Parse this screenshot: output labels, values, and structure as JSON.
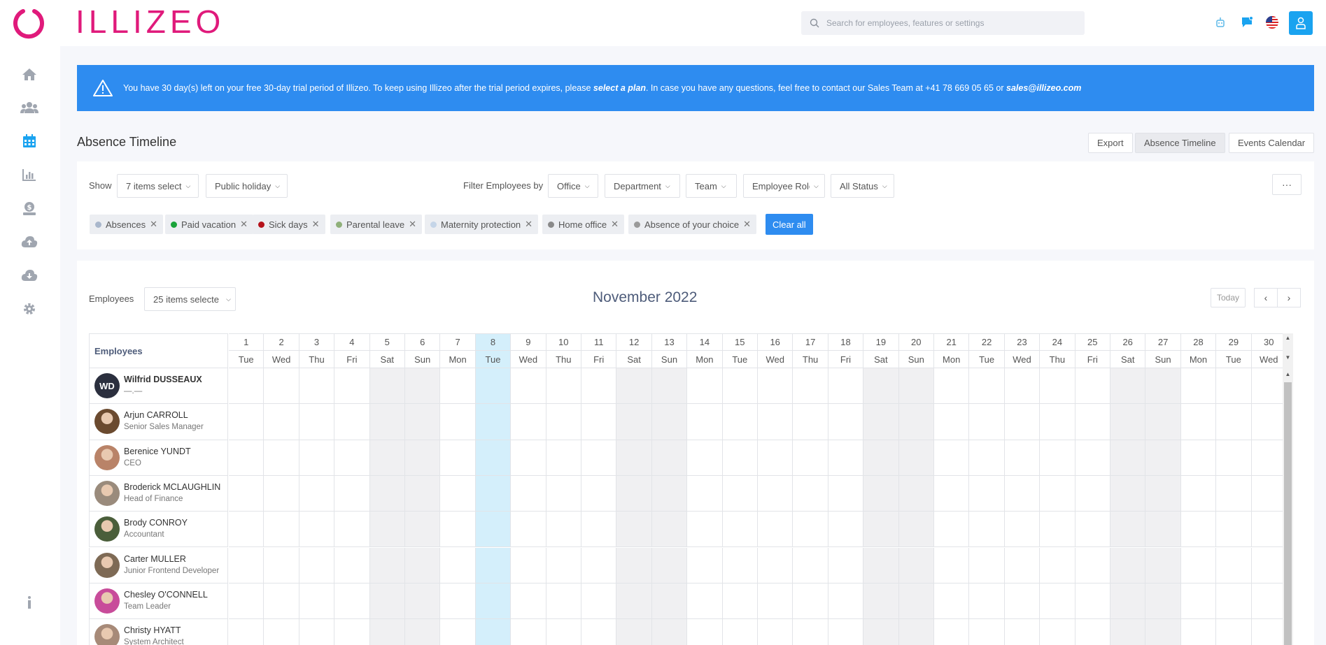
{
  "app": {
    "logo_text": "ILLIZEO"
  },
  "search": {
    "placeholder": "Search for employees, features or settings"
  },
  "banner": {
    "text_before": "You have 30 day(s) left on your free 30-day trial period of Illizeo. To keep using Illizeo after the trial period expires, please ",
    "link_text": "select a plan",
    "text_after": ". In case you have any questions, feel free to contact our Sales Team at +41 78 669 05 65 or ",
    "email": "sales@illizeo.com"
  },
  "page": {
    "title": "Absence Timeline"
  },
  "views": {
    "export": "Export",
    "timeline": "Absence Timeline",
    "events": "Events Calendar"
  },
  "filters": {
    "show_label": "Show",
    "items_select": "7 items select",
    "public_holiday": "Public holiday",
    "filter_by_label": "Filter Employees by",
    "office": "Office",
    "department": "Department",
    "team": "Team",
    "employee_role": "Employee Role",
    "all_status": "All Status",
    "more": "···",
    "clear_all": "Clear all"
  },
  "chips": [
    {
      "label": "Absences",
      "color": "#a9b7cc"
    },
    {
      "label": "Paid vacation",
      "color": "#1aa33a"
    },
    {
      "label": "Sick days",
      "color": "#b5121b"
    },
    {
      "label": "Parental leave",
      "color": "#8fb07a"
    },
    {
      "label": "Maternity protection",
      "color": "#c5d5e8"
    },
    {
      "label": "Home office",
      "color": "#8a8a8a"
    },
    {
      "label": "Absence of your choice",
      "color": "#9a9a9a"
    }
  ],
  "calendar": {
    "employees_label": "Employees",
    "employees_select": "25 items selecte",
    "month": "November 2022",
    "today": "Today",
    "header_employees": "Employees",
    "today_day": 8,
    "days": [
      {
        "n": "1",
        "d": "Tue"
      },
      {
        "n": "2",
        "d": "Wed"
      },
      {
        "n": "3",
        "d": "Thu"
      },
      {
        "n": "4",
        "d": "Fri"
      },
      {
        "n": "5",
        "d": "Sat"
      },
      {
        "n": "6",
        "d": "Sun"
      },
      {
        "n": "7",
        "d": "Mon"
      },
      {
        "n": "8",
        "d": "Tue"
      },
      {
        "n": "9",
        "d": "Wed"
      },
      {
        "n": "10",
        "d": "Thu"
      },
      {
        "n": "11",
        "d": "Fri"
      },
      {
        "n": "12",
        "d": "Sat"
      },
      {
        "n": "13",
        "d": "Sun"
      },
      {
        "n": "14",
        "d": "Mon"
      },
      {
        "n": "15",
        "d": "Tue"
      },
      {
        "n": "16",
        "d": "Wed"
      },
      {
        "n": "17",
        "d": "Thu"
      },
      {
        "n": "18",
        "d": "Fri"
      },
      {
        "n": "19",
        "d": "Sat"
      },
      {
        "n": "20",
        "d": "Sun"
      },
      {
        "n": "21",
        "d": "Mon"
      },
      {
        "n": "22",
        "d": "Tue"
      },
      {
        "n": "23",
        "d": "Wed"
      },
      {
        "n": "24",
        "d": "Thu"
      },
      {
        "n": "25",
        "d": "Fri"
      },
      {
        "n": "26",
        "d": "Sat"
      },
      {
        "n": "27",
        "d": "Sun"
      },
      {
        "n": "28",
        "d": "Mon"
      },
      {
        "n": "29",
        "d": "Tue"
      },
      {
        "n": "30",
        "d": "Wed"
      }
    ],
    "employees": [
      {
        "name": "Wilfrid DUSSEAUX",
        "role": "—.—",
        "initials": "WD",
        "bold": true,
        "color": "#2b2f3e"
      },
      {
        "name": "Arjun CARROLL",
        "role": "Senior Sales Manager",
        "color": "#6b4a2f"
      },
      {
        "name": "Berenice YUNDT",
        "role": "CEO",
        "color": "#b98368"
      },
      {
        "name": "Broderick MCLAUGHLIN",
        "role": "Head of Finance",
        "color": "#9a8b7c"
      },
      {
        "name": "Brody CONROY",
        "role": "Accountant",
        "color": "#4a5e3a"
      },
      {
        "name": "Carter MULLER",
        "role": "Junior Frontend Developer",
        "color": "#7e6a55"
      },
      {
        "name": "Chesley O'CONNELL",
        "role": "Team Leader",
        "color": "#c84c9a"
      },
      {
        "name": "Christy HYATT",
        "role": "System Architect",
        "color": "#a78a78"
      }
    ]
  }
}
